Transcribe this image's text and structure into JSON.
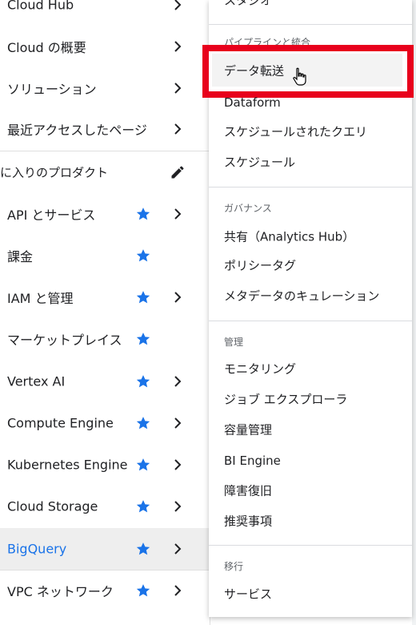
{
  "left_nav": {
    "top_items": [
      {
        "label": "Cloud Hub"
      },
      {
        "label": "Cloud の概要"
      },
      {
        "label": "ソリューション"
      },
      {
        "label": "最近アクセスしたページ"
      }
    ],
    "favorites_header": "に入りのプロダクト",
    "favorites": [
      {
        "label": "API とサービス"
      },
      {
        "label": "課金"
      },
      {
        "label": "IAM と管理"
      },
      {
        "label": "マーケットプレイス"
      },
      {
        "label": "Vertex AI"
      },
      {
        "label": "Compute Engine"
      },
      {
        "label": "Kubernetes Engine"
      },
      {
        "label": "Cloud Storage"
      },
      {
        "label": "BigQuery"
      },
      {
        "label": "VPC ネットワーク"
      }
    ],
    "accent_color": "#1a73e8",
    "star_color": "#1a73e8"
  },
  "submenu": {
    "partial_top_item": "スタジオ",
    "sections": [
      {
        "header": "パイプラインと統合",
        "items": [
          {
            "label": "データ転送"
          },
          {
            "label": "Dataform"
          },
          {
            "label": "スケジュールされたクエリ"
          },
          {
            "label": "スケジュール"
          }
        ]
      },
      {
        "header": "ガバナンス",
        "items": [
          {
            "label": "共有（Analytics Hub）"
          },
          {
            "label": "ポリシータグ"
          },
          {
            "label": "メタデータのキュレーション"
          }
        ]
      },
      {
        "header": "管理",
        "items": [
          {
            "label": "モニタリング"
          },
          {
            "label": "ジョブ エクスプローラ"
          },
          {
            "label": "容量管理"
          },
          {
            "label": "BI Engine"
          },
          {
            "label": "障害復旧"
          },
          {
            "label": "推奨事項"
          }
        ]
      },
      {
        "header": "移行",
        "items": [
          {
            "label": "サービス"
          }
        ]
      }
    ],
    "highlight_color": "#e8001c"
  }
}
